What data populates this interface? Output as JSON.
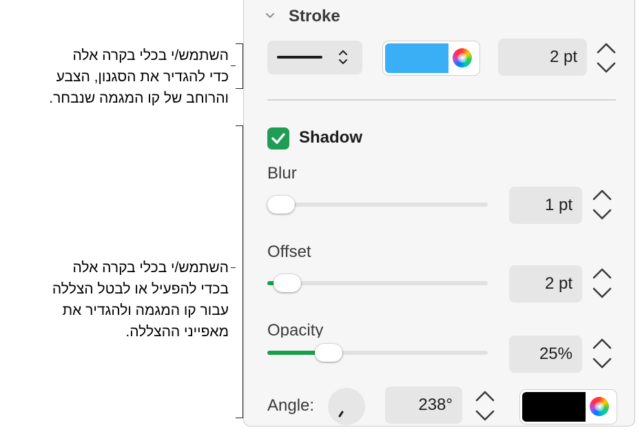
{
  "callouts": {
    "stroke_text": [
      "השתמש/י בכלי בקרה אלה",
      "כדי להגדיר את הסגנון, הצבע",
      "והרוחב של קו המגמה שנבחר."
    ],
    "shadow_text": [
      "השתמש/י בכלי בקרה אלה",
      "בכדי להפעיל או לבטל הצללה",
      "עבור קו המגמה ולהגדיר את",
      "מאפייני ההצללה."
    ]
  },
  "stroke": {
    "title": "Stroke",
    "style_value": "solid-line",
    "color": "#3aaff5",
    "width_value": "2 pt"
  },
  "shadow": {
    "title": "Shadow",
    "enabled": true,
    "blur": {
      "label": "Blur",
      "value": "1 pt",
      "fraction": 0.02
    },
    "offset": {
      "label": "Offset",
      "value": "2 pt",
      "fraction": 0.07
    },
    "opacity": {
      "label": "Opacity",
      "value": "25%",
      "fraction": 0.25
    },
    "angle": {
      "label": "Angle:",
      "value": "238°"
    },
    "color": "#000000"
  },
  "colors": {
    "accent_green": "#16a04a",
    "check_green": "#1f9d55"
  }
}
